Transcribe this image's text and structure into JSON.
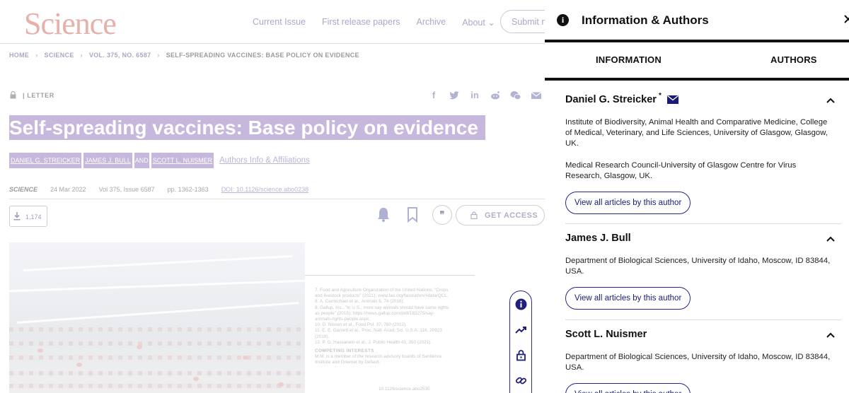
{
  "site": {
    "logo": "Science",
    "nav": [
      "Current Issue",
      "First release papers",
      "Archive",
      "About"
    ],
    "submit_label": "Submit manuscript"
  },
  "breadcrumb": [
    "HOME",
    "SCIENCE",
    "VOL. 375, NO. 6587",
    "SELF-SPREADING VACCINES: BASE POLICY ON EVIDENCE"
  ],
  "article": {
    "type": "LETTER",
    "title": "Self-spreading vaccines: Base policy on evidence",
    "authors": [
      "DANIEL G. STREICKER",
      "JAMES J. BULL",
      "SCOTT L. NUISMER"
    ],
    "and_label": "AND",
    "affiliations_link": "Authors Info & Affiliations",
    "journal": "SCIENCE",
    "date": "24 Mar 2022",
    "volume": "Vol 375, Issue 6587",
    "pages": "pp. 1362-1363",
    "doi": "DOI: 10.1126/science.abo0238",
    "downloads": "1,174",
    "access_label": "GET ACCESS",
    "cite_glyph": "❞",
    "share_icons": [
      "facebook-icon",
      "twitter-icon",
      "linkedin-icon",
      "reddit-icon",
      "wechat-icon",
      "email-icon"
    ]
  },
  "page_scan": {
    "refs": [
      "7. Food and Agriculture Organization of the United Nations, “Crops and livestock products” (2021); www.fao.org/faostat/en/#data/QCL.",
      "8. A. Carmichael et al., Animals 6, 74 (2016).",
      "9. Gallup, Inc., “In U.S., more say animals should have same rights as people” (2015); https://news.gallup.com/poll/183275/say-animals-rights-people.aspx.",
      "10. D. Nissen et al., Food Pol. 37, 760 (2012).",
      "11. E. E. Garnett et al., Proc. Natl. Acad. Sci. U.S.A. 116, 20923 (2019).",
      "12. P. G. Hassanein et al., J. Public Health 43, 350 (2021)."
    ],
    "competing_heading": "COMPETING INTERESTS",
    "competing_text": "M.M. is a member of the research advisory boards of Sentience Institute and Greener by Default.",
    "page_doi": "10.1126/science.abo2535"
  },
  "drawer": {
    "title": "Information & Authors",
    "tabs": [
      "INFORMATION",
      "AUTHORS"
    ],
    "view_label": "View all articles by this author",
    "authors": [
      {
        "name": "Daniel G. Streicker",
        "star": "*",
        "affiliations": [
          "Institute of Biodiversity, Animal Health and Comparative Medicine, College of Medical, Veterinary, and Life Sciences, University of Glasgow, Glasgow, UK.",
          "Medical Research Council-University of Glasgow Centre for Virus Research, Glasgow, UK."
        ]
      },
      {
        "name": "James J. Bull",
        "affiliations": [
          "Department of Biological Sciences, University of Idaho, Moscow, ID 83844, USA."
        ]
      },
      {
        "name": "Scott L. Nuismer",
        "affiliations": [
          "Department of Biological Sciences, University of Idaho, Moscow, ID 83844, USA."
        ]
      }
    ]
  },
  "colors": {
    "accent": "#26268a",
    "highlight": "#c6b7dd",
    "logo": "#e7b0aa"
  }
}
